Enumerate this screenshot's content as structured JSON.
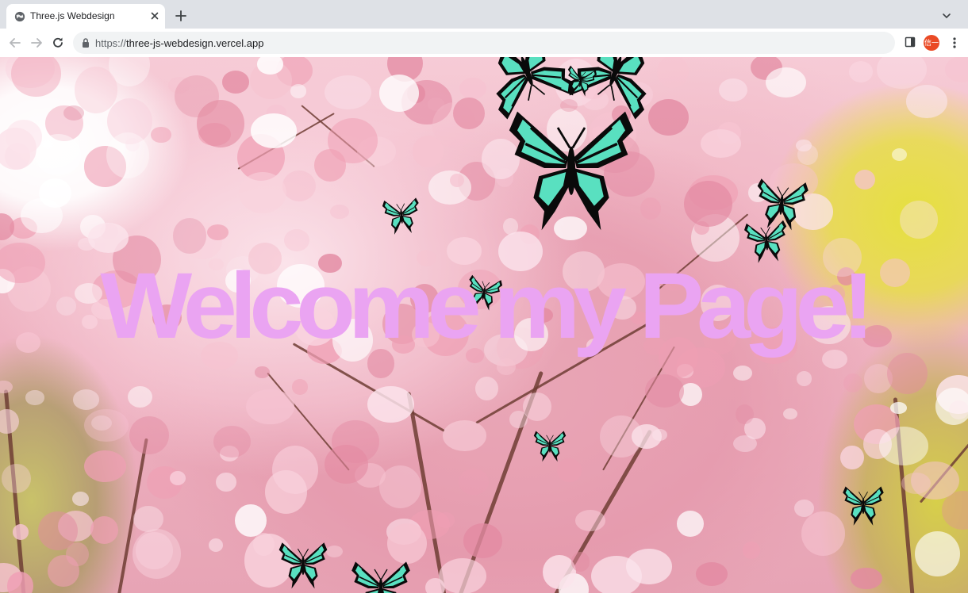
{
  "browser": {
    "tab_title": "Three.js Webdesign",
    "url_scheme": "https://",
    "url_host": "three-js-webdesign.vercel.app",
    "avatar_label": "信一",
    "icons": [
      "globe-icon",
      "close-icon",
      "plus-icon",
      "chevron-down-icon",
      "back-arrow-icon",
      "forward-arrow-icon",
      "reload-icon",
      "lock-icon",
      "side-panel-icon",
      "kebab-menu-icon"
    ]
  },
  "page": {
    "headline": "Welcome my Page!",
    "headline_color": "#eaa4f2",
    "butterfly_wing_color": "#59e0c0",
    "butterfly_body_color": "#0a0a0a"
  }
}
